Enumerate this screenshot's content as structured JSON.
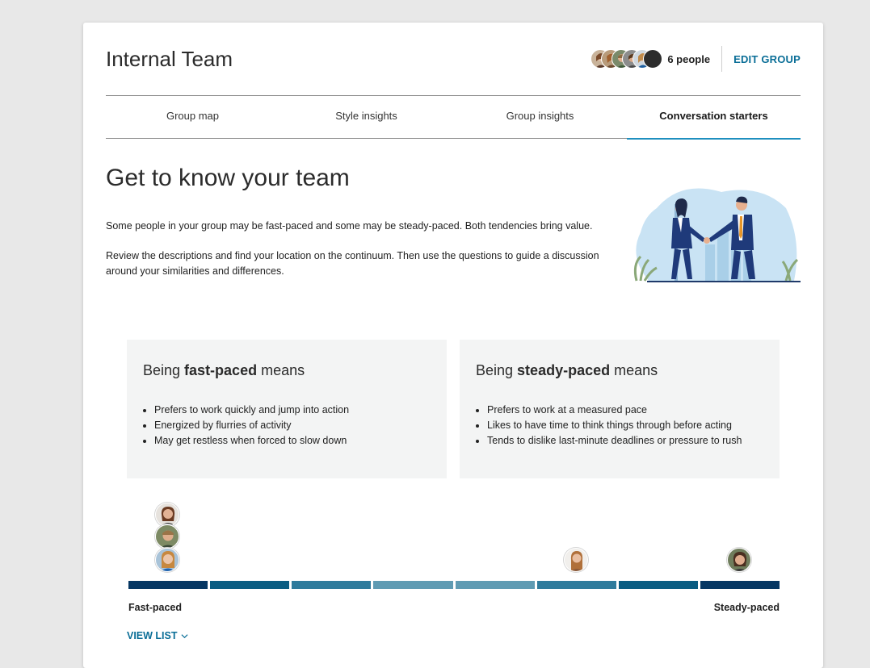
{
  "header": {
    "group_title": "Internal Team",
    "people_count": "6 people",
    "edit_label": "EDIT GROUP"
  },
  "tabs": [
    {
      "label": "Group map",
      "active": false
    },
    {
      "label": "Style insights",
      "active": false
    },
    {
      "label": "Group insights",
      "active": false
    },
    {
      "label": "Conversation starters",
      "active": true
    }
  ],
  "main": {
    "title": "Get to know your team",
    "intro_1": "Some people in your group may be fast-paced and some may be steady-paced. Both tendencies bring value.",
    "intro_2": "Review the descriptions and find your location on the continuum. Then use the questions to guide a discussion around your similarities and differences."
  },
  "panels": {
    "fast": {
      "prefix": "Being ",
      "emphasis": "fast-paced",
      "suffix": " means",
      "items": [
        "Prefers to work quickly and jump into action",
        "Energized by flurries of activity",
        "May get restless when forced to slow down"
      ]
    },
    "steady": {
      "prefix": "Being ",
      "emphasis": "steady-paced",
      "suffix": " means",
      "items": [
        "Prefers to work at a measured pace",
        "Likes to have time to think things through before acting",
        "Tends to dislike last-minute deadlines or pressure to rush"
      ]
    }
  },
  "continuum": {
    "left_label": "Fast-paced",
    "right_label": "Steady-paced",
    "segment_colors": [
      "#063763",
      "#0a5c82",
      "#2f7b9c",
      "#5f9bb3",
      "#5f9bb3",
      "#2f7b9c",
      "#0a5c82",
      "#063763"
    ]
  },
  "footer": {
    "view_list": "VIEW LIST"
  },
  "colors": {
    "accent": "#0a6e97",
    "tab_underline": "#1e8fbf"
  }
}
